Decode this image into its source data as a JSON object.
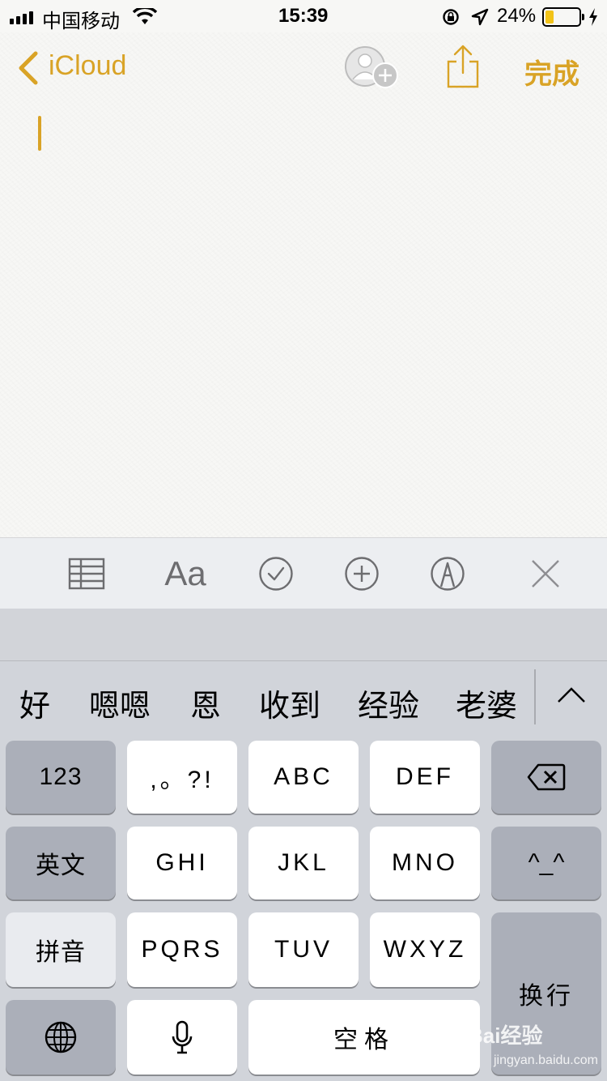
{
  "status_bar": {
    "carrier": "中国移动",
    "time": "15:39",
    "battery": "24%"
  },
  "nav": {
    "back_label": "iCloud",
    "done_label": "完成"
  },
  "note": {
    "content": ""
  },
  "toolbar": {
    "aa_label": "Aa"
  },
  "candidates": [
    "好",
    "嗯嗯",
    "恩",
    "收到",
    "经验",
    "老婆"
  ],
  "keyboard": {
    "row1": [
      "123",
      ",。?!",
      "ABC",
      "DEF"
    ],
    "row2": [
      "英文",
      "GHI",
      "JKL",
      "MNO",
      "^_^"
    ],
    "row3": [
      "拼音",
      "PQRS",
      "TUV",
      "WXYZ",
      "换行"
    ],
    "row4": {
      "space": "空格"
    }
  },
  "watermark": {
    "text": "Bai经验",
    "sub": "jingyan.baidu.com"
  },
  "colors": {
    "accent": "#d9a326"
  }
}
